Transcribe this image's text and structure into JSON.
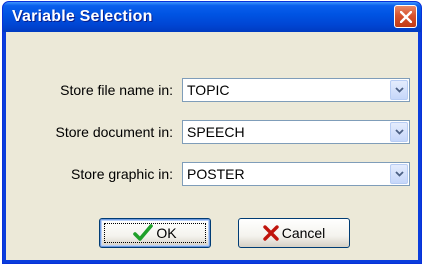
{
  "window": {
    "title": "Variable Selection",
    "close_icon": "close-icon"
  },
  "fields": [
    {
      "label": "Store file name in:",
      "value": "TOPIC"
    },
    {
      "label": "Store document in:",
      "value": "SPEECH"
    },
    {
      "label": "Store graphic in:",
      "value": "POSTER"
    }
  ],
  "buttons": {
    "ok_label": "OK",
    "ok_icon": "checkmark-icon",
    "cancel_label": "Cancel",
    "cancel_icon": "x-cross-icon"
  },
  "colors": {
    "titlebar": "#0054e3",
    "client_bg": "#ece9d8",
    "ok_check": "#1fa02a",
    "cancel_x": "#c0140c"
  }
}
